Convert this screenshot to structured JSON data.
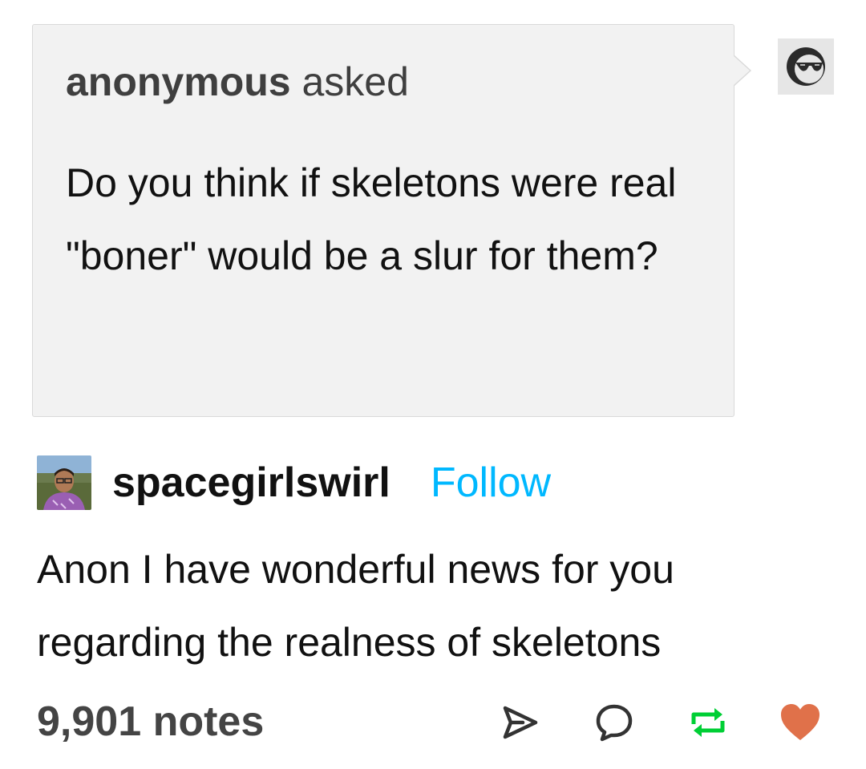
{
  "ask": {
    "asker": "anonymous",
    "verb": "asked",
    "question": "Do you think if skeletons were real \"boner\" would be a slur for them?"
  },
  "answer": {
    "username": "spacegirlswirl",
    "follow_label": "Follow",
    "text": "Anon I have wonderful news for you regarding the realness of skeletons"
  },
  "footer": {
    "notes_label": "9,901 notes"
  },
  "icons": {
    "anon_avatar": "sunglasses-face-icon",
    "share": "share-arrow-icon",
    "reply": "reply-bubble-icon",
    "reblog": "reblog-icon",
    "like": "heart-icon"
  },
  "colors": {
    "follow": "#00b8ff",
    "reblog": "#00cf35",
    "like": "#e0714a",
    "ask_background": "#f2f2f2"
  }
}
